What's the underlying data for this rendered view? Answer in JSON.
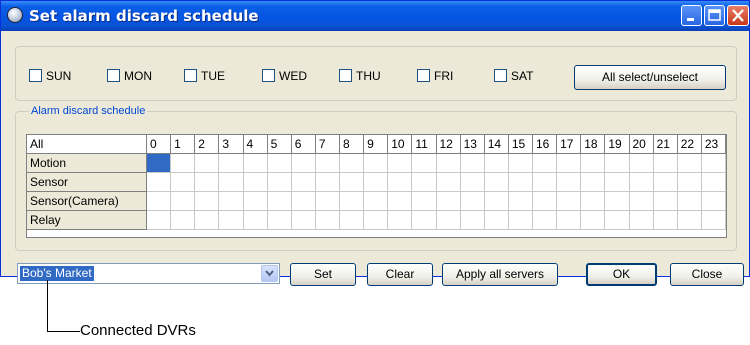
{
  "window": {
    "title": "Set alarm discard schedule"
  },
  "days": [
    {
      "label": "SUN",
      "checked": false
    },
    {
      "label": "MON",
      "checked": false
    },
    {
      "label": "TUE",
      "checked": false
    },
    {
      "label": "WED",
      "checked": false
    },
    {
      "label": "THU",
      "checked": false
    },
    {
      "label": "FRI",
      "checked": false
    },
    {
      "label": "SAT",
      "checked": false
    }
  ],
  "all_select_label": "All select/unselect",
  "schedule": {
    "group_label": "Alarm discard schedule",
    "corner_label": "All",
    "hours": [
      "0",
      "1",
      "2",
      "3",
      "4",
      "5",
      "6",
      "7",
      "8",
      "9",
      "10",
      "11",
      "12",
      "13",
      "14",
      "15",
      "16",
      "17",
      "18",
      "19",
      "20",
      "21",
      "22",
      "23"
    ],
    "rows": [
      "Motion",
      "Sensor",
      "Sensor(Camera)",
      "Relay"
    ],
    "selected_cell": {
      "row": "Motion",
      "hour": "0"
    },
    "selection_color": "#316ac5"
  },
  "server_select": {
    "value": "Bob's Market"
  },
  "buttons": {
    "set": "Set",
    "clear": "Clear",
    "apply_all": "Apply all servers",
    "ok": "OK",
    "close": "Close"
  },
  "callout": {
    "text": "Connected DVRs"
  }
}
